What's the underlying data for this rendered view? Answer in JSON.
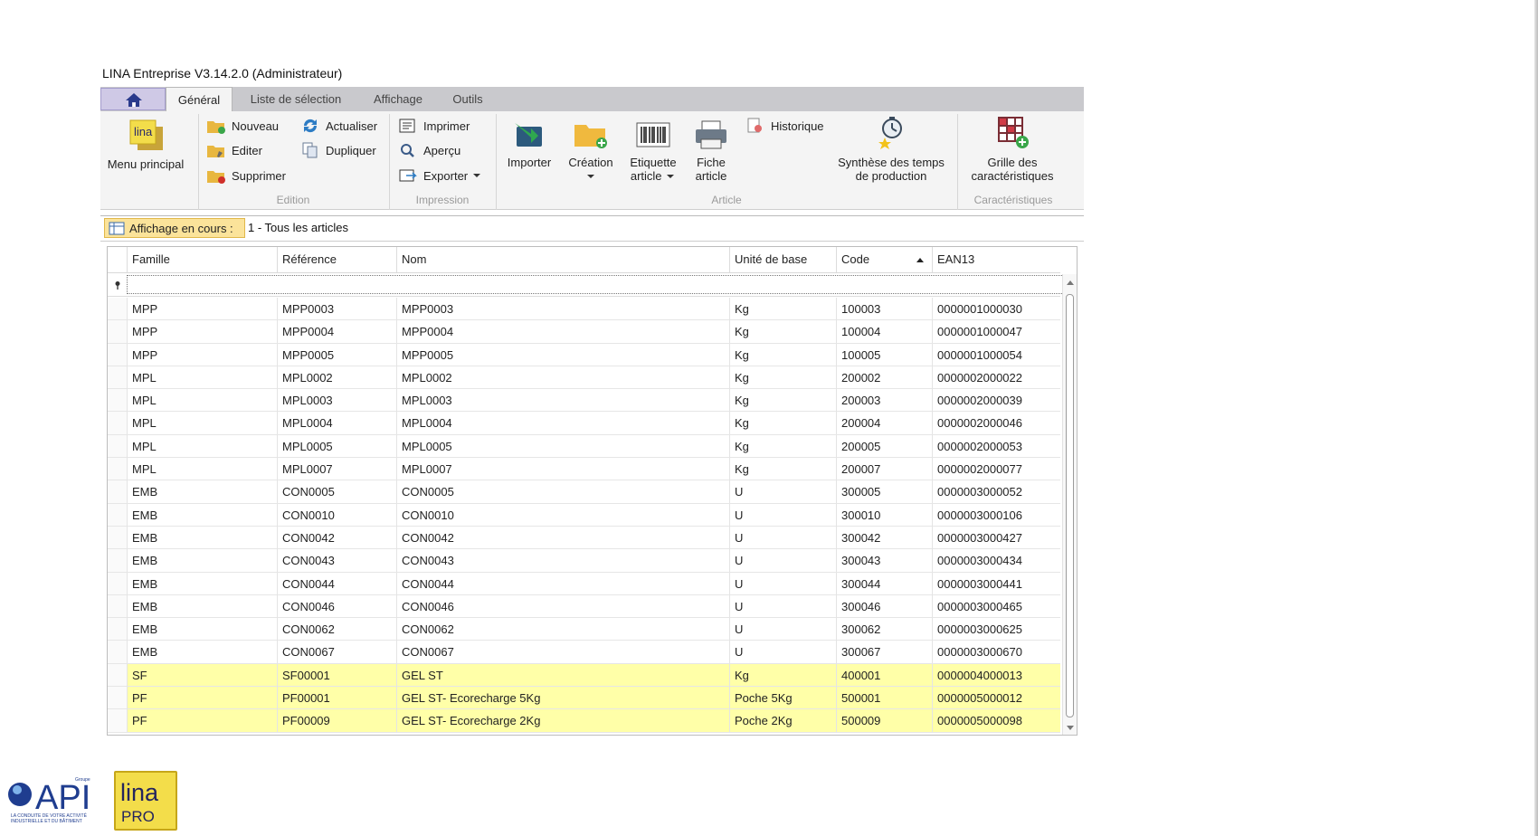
{
  "window": {
    "title": "LINA Entreprise  V3.14.2.0  (Administrateur)"
  },
  "tabs": [
    {
      "label": "Général",
      "active": true
    },
    {
      "label": "Liste de sélection",
      "active": false
    },
    {
      "label": "Affichage",
      "active": false
    },
    {
      "label": "Outils",
      "active": false
    }
  ],
  "ribbon": {
    "main_menu": {
      "label": "Menu principal",
      "logo_text": "lina"
    },
    "edition": {
      "label": "Edition",
      "nouveau": "Nouveau",
      "editer": "Editer",
      "supprimer": "Supprimer",
      "actualiser": "Actualiser",
      "dupliquer": "Dupliquer"
    },
    "impression": {
      "label": "Impression",
      "imprimer": "Imprimer",
      "apercu": "Aperçu",
      "exporter": "Exporter"
    },
    "article": {
      "label": "Article",
      "importer": "Importer",
      "creation": "Création",
      "etiquette_line1": "Etiquette",
      "etiquette_line2": "article",
      "fiche_line1": "Fiche",
      "fiche_line2": "article",
      "historique": "Historique",
      "synthese_line1": "Synthèse des temps",
      "synthese_line2": "de production"
    },
    "caracteristiques": {
      "label": "Caractéristiques",
      "grille_line1": "Grille des",
      "grille_line2": "caractéristiques"
    }
  },
  "view": {
    "label": "Affichage en cours :",
    "value": "1 - Tous les articles"
  },
  "grid": {
    "columns": [
      "Famille",
      "Référence",
      "Nom",
      "Unité de base",
      "Code",
      "EAN13"
    ],
    "sort_column": "Code",
    "rows": [
      {
        "famille": "MPP",
        "reference": "MPP0003",
        "nom": "MPP0003",
        "unite": "Kg",
        "code": "100003",
        "ean13": "0000001000030",
        "highlight": false
      },
      {
        "famille": "MPP",
        "reference": "MPP0004",
        "nom": "MPP0004",
        "unite": "Kg",
        "code": "100004",
        "ean13": "0000001000047",
        "highlight": false
      },
      {
        "famille": "MPP",
        "reference": "MPP0005",
        "nom": "MPP0005",
        "unite": "Kg",
        "code": "100005",
        "ean13": "0000001000054",
        "highlight": false
      },
      {
        "famille": "MPL",
        "reference": "MPL0002",
        "nom": "MPL0002",
        "unite": "Kg",
        "code": "200002",
        "ean13": "0000002000022",
        "highlight": false
      },
      {
        "famille": "MPL",
        "reference": "MPL0003",
        "nom": "MPL0003",
        "unite": "Kg",
        "code": "200003",
        "ean13": "0000002000039",
        "highlight": false
      },
      {
        "famille": "MPL",
        "reference": "MPL0004",
        "nom": "MPL0004",
        "unite": "Kg",
        "code": "200004",
        "ean13": "0000002000046",
        "highlight": false
      },
      {
        "famille": "MPL",
        "reference": "MPL0005",
        "nom": "MPL0005",
        "unite": "Kg",
        "code": "200005",
        "ean13": "0000002000053",
        "highlight": false
      },
      {
        "famille": "MPL",
        "reference": "MPL0007",
        "nom": "MPL0007",
        "unite": "Kg",
        "code": "200007",
        "ean13": "0000002000077",
        "highlight": false
      },
      {
        "famille": "EMB",
        "reference": "CON0005",
        "nom": "CON0005",
        "unite": "U",
        "code": "300005",
        "ean13": "0000003000052",
        "highlight": false
      },
      {
        "famille": "EMB",
        "reference": "CON0010",
        "nom": "CON0010",
        "unite": "U",
        "code": "300010",
        "ean13": "0000003000106",
        "highlight": false
      },
      {
        "famille": "EMB",
        "reference": "CON0042",
        "nom": "CON0042",
        "unite": "U",
        "code": "300042",
        "ean13": "0000003000427",
        "highlight": false
      },
      {
        "famille": "EMB",
        "reference": "CON0043",
        "nom": "CON0043",
        "unite": "U",
        "code": "300043",
        "ean13": "0000003000434",
        "highlight": false
      },
      {
        "famille": "EMB",
        "reference": "CON0044",
        "nom": "CON0044",
        "unite": "U",
        "code": "300044",
        "ean13": "0000003000441",
        "highlight": false
      },
      {
        "famille": "EMB",
        "reference": "CON0046",
        "nom": "CON0046",
        "unite": "U",
        "code": "300046",
        "ean13": "0000003000465",
        "highlight": false
      },
      {
        "famille": "EMB",
        "reference": "CON0062",
        "nom": "CON0062",
        "unite": "U",
        "code": "300062",
        "ean13": "0000003000625",
        "highlight": false
      },
      {
        "famille": "EMB",
        "reference": "CON0067",
        "nom": "CON0067",
        "unite": "U",
        "code": "300067",
        "ean13": "0000003000670",
        "highlight": false
      },
      {
        "famille": "SF",
        "reference": "SF00001",
        "nom": "GEL ST",
        "unite": "Kg",
        "code": "400001",
        "ean13": "0000004000013",
        "highlight": true
      },
      {
        "famille": "PF",
        "reference": "PF00001",
        "nom": "GEL ST- Ecorecharge 5Kg",
        "unite": "Poche 5Kg",
        "code": "500001",
        "ean13": "0000005000012",
        "highlight": true
      },
      {
        "famille": "PF",
        "reference": "PF00009",
        "nom": "GEL ST- Ecorecharge 2Kg",
        "unite": "Poche 2Kg",
        "code": "500009",
        "ean13": "0000005000098",
        "highlight": true
      }
    ]
  },
  "footer": {
    "api_logo": {
      "brand": "API",
      "tagline_top": "Groupe",
      "tagline_line1": "LA CONDUITE DE VOTRE ACTIVITÉ",
      "tagline_line2": "INDUSTRIELLE ET DU BÂTIMENT"
    },
    "lina_logo": {
      "top": "lina",
      "bottom": "PRO"
    }
  },
  "colors": {
    "highlight_row": "#ffffa8",
    "view_label_bg": "#fbe39a",
    "tab_bar": "#c9c9cd"
  }
}
